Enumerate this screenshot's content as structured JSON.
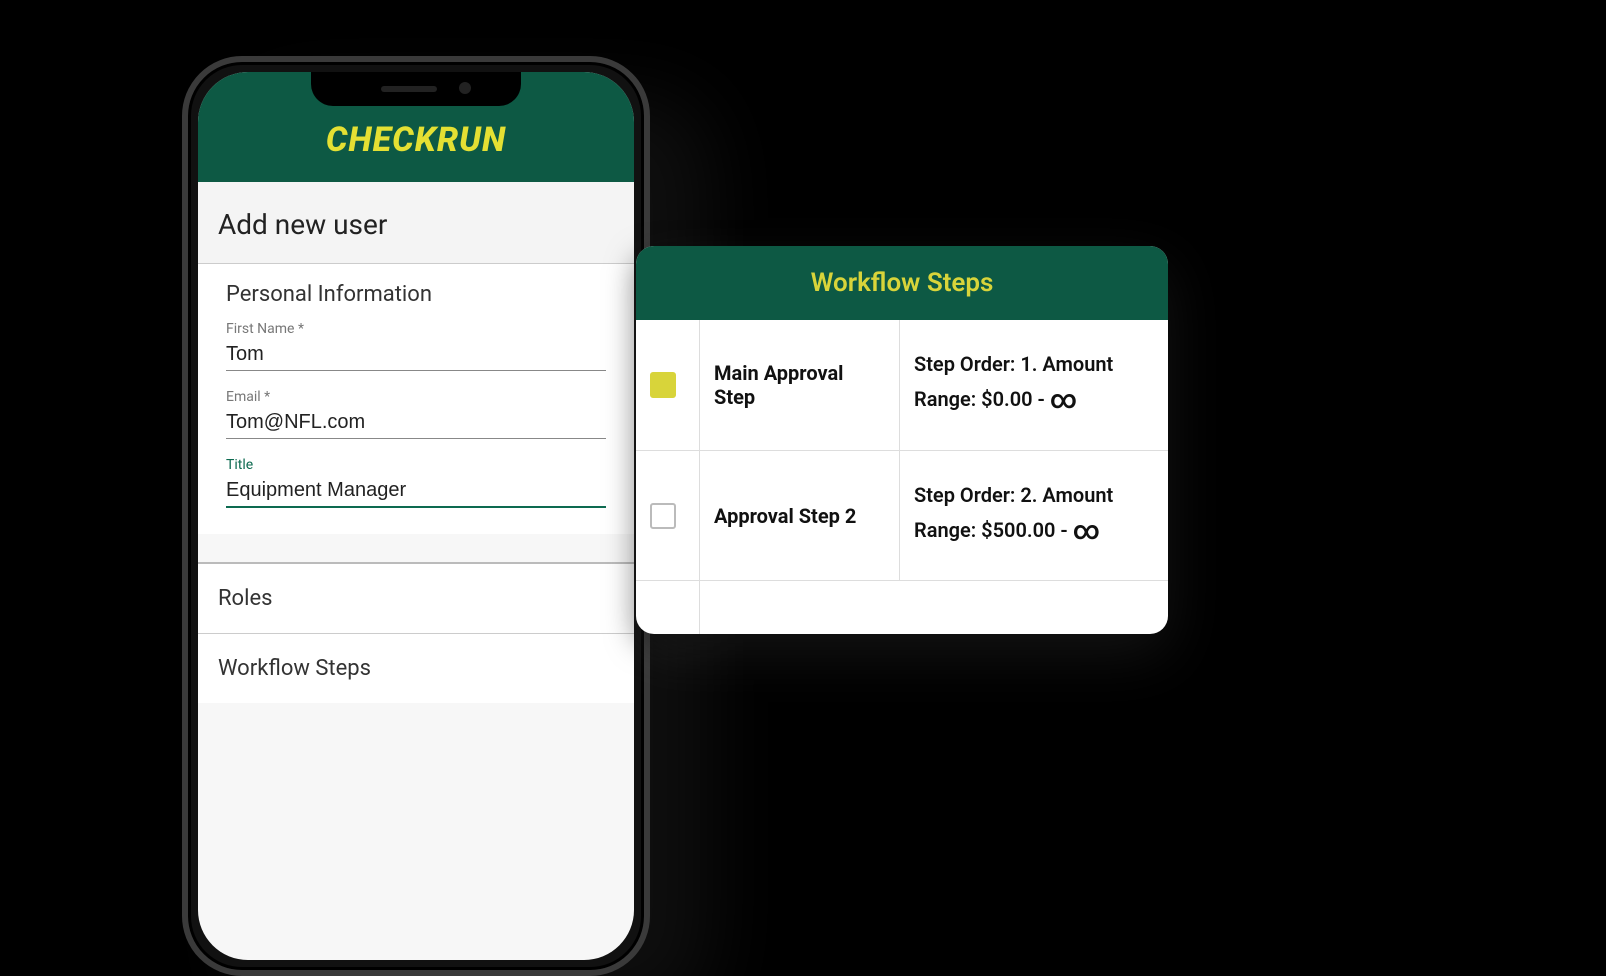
{
  "app": {
    "brand": "CHECKRUN",
    "page_title": "Add new user"
  },
  "personal": {
    "heading": "Personal Information",
    "first_name_label": "First Name *",
    "first_name_value": "Tom",
    "email_label": "Email *",
    "email_value": "Tom@NFL.com",
    "title_label": "Title",
    "title_value": "Equipment Manager"
  },
  "sections": {
    "roles": "Roles",
    "workflow": "Workflow Steps"
  },
  "workflow_card": {
    "title": "Workflow Steps",
    "steps": [
      {
        "checked": true,
        "name": "Main Approval Step",
        "meta": "Step Order: 1. Amount Range: $0.00 - ∞"
      },
      {
        "checked": false,
        "name": "Approval Step 2",
        "meta": "Step Order: 2. Amount Range: $500.00 - ∞"
      }
    ]
  }
}
